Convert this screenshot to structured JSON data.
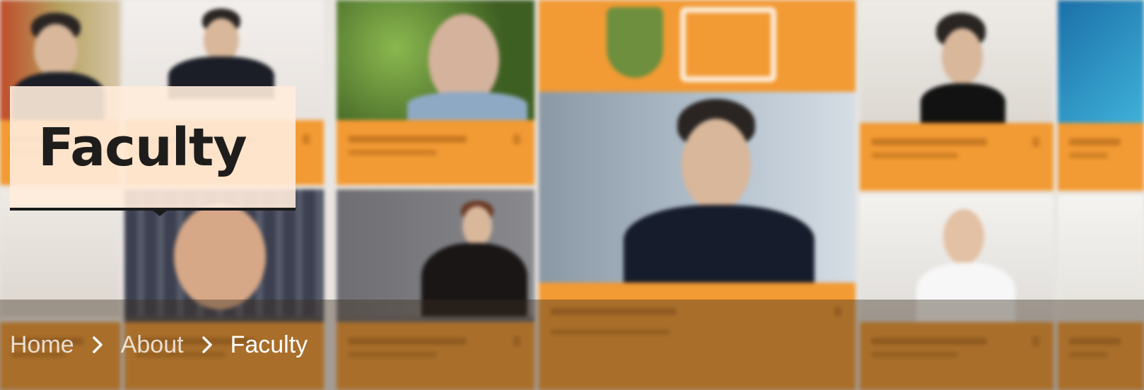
{
  "hero": {
    "title": "Faculty"
  },
  "breadcrumb": {
    "items": [
      {
        "label": "Home"
      },
      {
        "label": "About"
      },
      {
        "label": "Faculty"
      }
    ],
    "separator_icon": "chevron-right-icon"
  },
  "colors": {
    "accent_orange": "#f29a33",
    "title_box_bg": "#ffecdc",
    "title_text": "#1e1d1c",
    "breadcrumb_text": "#ffffff"
  }
}
